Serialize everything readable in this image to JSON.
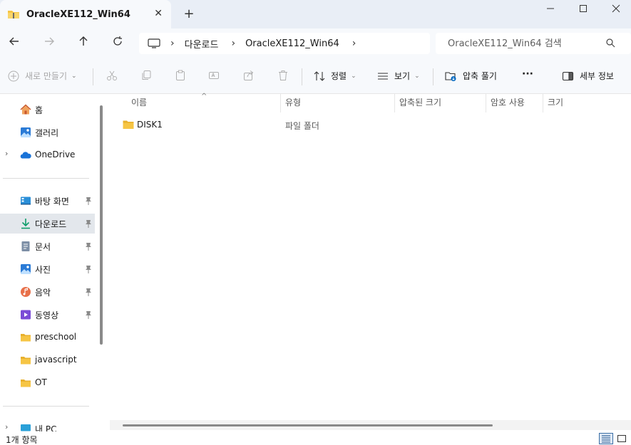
{
  "window": {
    "tab_title": "OracleXE112_Win64",
    "new_tab_symbol": "+",
    "close_tab_symbol": "✕"
  },
  "address": {
    "crumbs": [
      "다운로드",
      "OracleXE112_Win64"
    ],
    "search_placeholder": "OracleXE112_Win64 검색"
  },
  "toolbar": {
    "new_label": "새로 만들기",
    "sort_label": "정렬",
    "view_label": "보기",
    "extract_label": "압축 풀기",
    "more_label": "···",
    "details_label": "세부 정보"
  },
  "sidebar": {
    "top_items": [
      {
        "label": "홈",
        "icon": "home-icon"
      },
      {
        "label": "갤러리",
        "icon": "gallery-icon"
      },
      {
        "label": "OneDrive",
        "icon": "onedrive-icon"
      }
    ],
    "quick_items": [
      {
        "label": "바탕 화면",
        "icon": "desktop-icon",
        "pinned": true
      },
      {
        "label": "다운로드",
        "icon": "download-icon",
        "pinned": true,
        "selected": true
      },
      {
        "label": "문서",
        "icon": "documents-icon",
        "pinned": true
      },
      {
        "label": "사진",
        "icon": "pictures-icon",
        "pinned": true
      },
      {
        "label": "음악",
        "icon": "music-icon",
        "pinned": true
      },
      {
        "label": "동영상",
        "icon": "videos-icon",
        "pinned": true
      },
      {
        "label": "preschool",
        "icon": "folder-icon",
        "pinned": false
      },
      {
        "label": "javascript",
        "icon": "folder-icon",
        "pinned": false
      },
      {
        "label": "OT",
        "icon": "folder-icon",
        "pinned": false
      }
    ],
    "bottom_items": [
      {
        "label": "내 PC",
        "icon": "this-pc-icon"
      }
    ]
  },
  "columns": [
    "이름",
    "유형",
    "압축된 크기",
    "암호 사용",
    "크기"
  ],
  "files": [
    {
      "name": "DISK1",
      "type": "파일 폴더"
    }
  ],
  "status": {
    "item_count": "1개 항목"
  },
  "colors": {
    "folder": "#f6c544",
    "accent": "#0067c0",
    "selected_bg": "#e3e7ec"
  }
}
